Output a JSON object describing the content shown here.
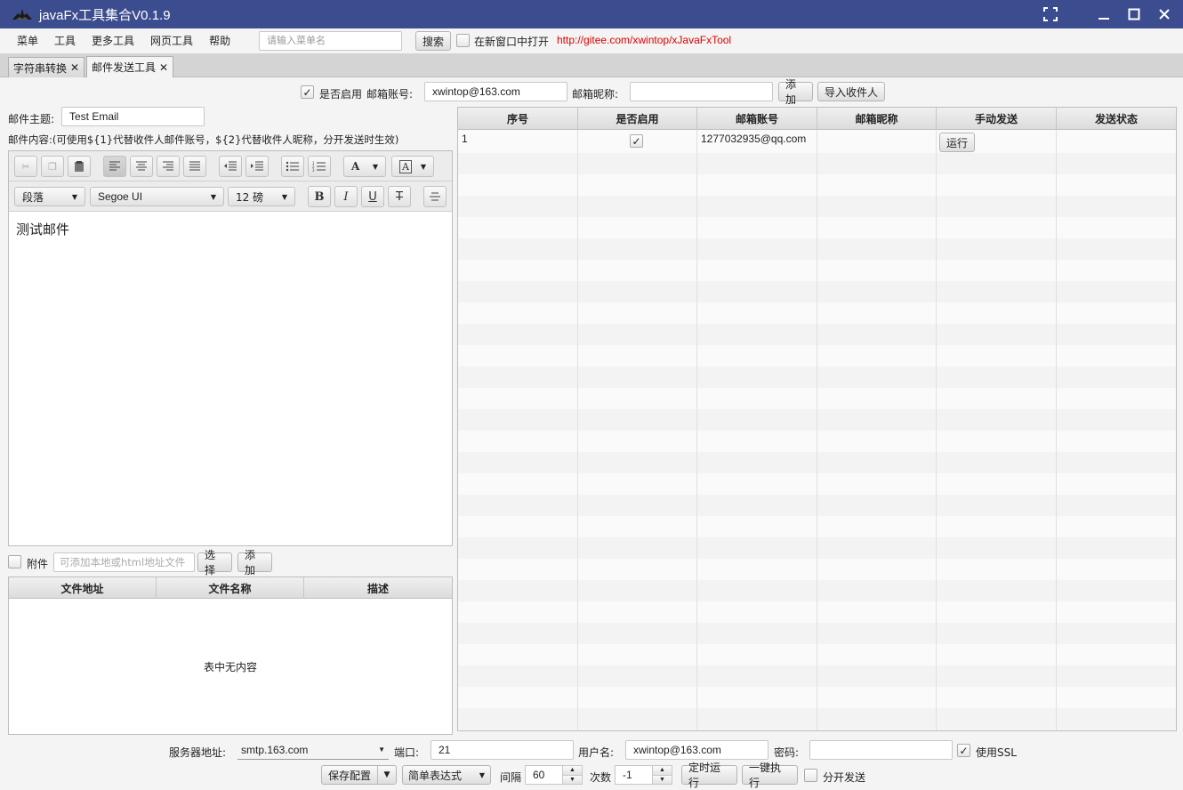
{
  "window": {
    "title": "javaFx工具集合V0.1.9"
  },
  "menu": {
    "items": [
      "菜单",
      "工具",
      "更多工具",
      "网页工具",
      "帮助"
    ],
    "search_placeholder": "请输入菜单名",
    "search_button": "搜索",
    "new_window_label": "在新窗口中打开",
    "link": "http://gitee.com/xwintop/xJavaFxTool"
  },
  "tabs": [
    {
      "label": "字符串转换",
      "close": "✕"
    },
    {
      "label": "邮件发送工具",
      "close": "✕"
    }
  ],
  "account_row": {
    "enabled_label": "是否启用",
    "account_label": "邮箱账号:",
    "account_value": "xwintop@163.com",
    "nickname_label": "邮箱昵称:",
    "nickname_value": "",
    "add_button": "添加",
    "import_button": "导入收件人"
  },
  "mail": {
    "subject_label": "邮件主题:",
    "subject_value": "Test Email",
    "content_label": "邮件内容:(可使用${1}代替收件人邮件账号，${2}代替收件人昵称，分开发送时生效)",
    "body": "测试邮件"
  },
  "editor_toolbar": {
    "paragraph": "段落",
    "font": "Segoe UI",
    "size": "12 磅"
  },
  "attachment": {
    "label": "附件",
    "placeholder": "可添加本地或html地址文件",
    "choose_button": "选择",
    "add_button": "添加",
    "columns": [
      "文件地址",
      "文件名称",
      "描述"
    ],
    "empty_text": "表中无内容"
  },
  "recipients": {
    "columns": [
      "序号",
      "是否启用",
      "邮箱账号",
      "邮箱昵称",
      "手动发送",
      "发送状态"
    ],
    "rows": [
      {
        "index": "1",
        "enabled": "✓",
        "email": "1277032935@qq.com",
        "nickname": "",
        "action": "运行",
        "status": ""
      }
    ]
  },
  "server": {
    "host_label": "服务器地址:",
    "host_value": "smtp.163.com",
    "port_label": "端口:",
    "port_value": "21",
    "user_label": "用户名:",
    "user_value": "xwintop@163.com",
    "password_label": "密码:",
    "password_value": "",
    "ssl_label": "使用SSL"
  },
  "actions": {
    "save_config": "保存配置",
    "expression": "简单表达式",
    "interval_label": "间隔",
    "interval_value": "60",
    "count_label": "次数",
    "count_value": "-1",
    "schedule_button": "定时运行",
    "run_all_button": "一键执行",
    "split_send_label": "分开发送"
  }
}
